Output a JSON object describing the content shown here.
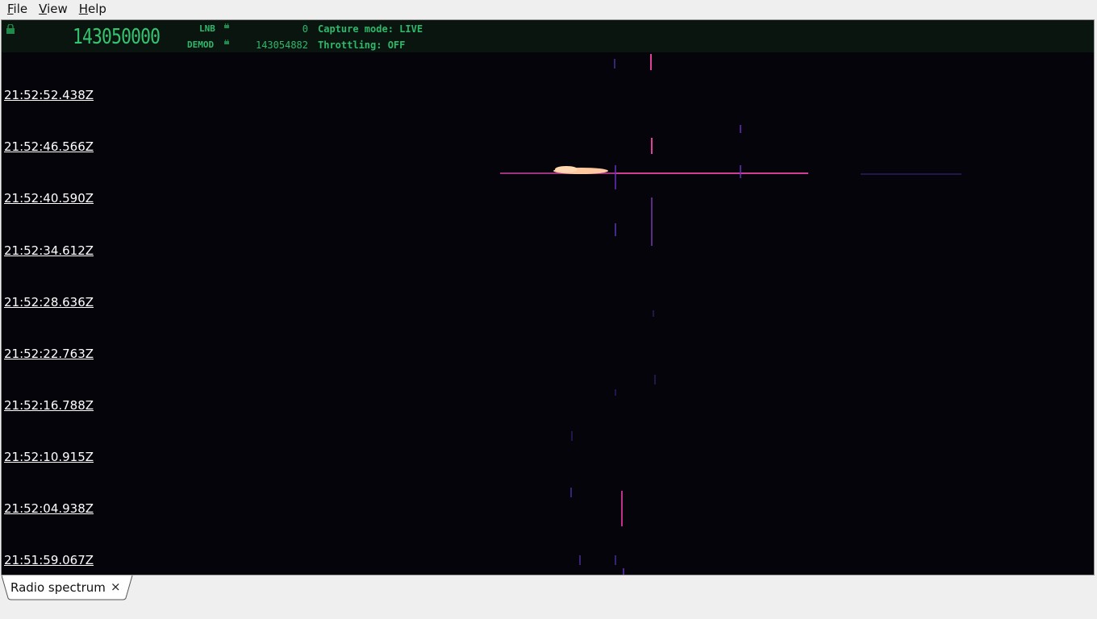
{
  "menu": [
    {
      "mnemonic": "F",
      "rest": "ile"
    },
    {
      "mnemonic": "V",
      "rest": "iew"
    },
    {
      "mnemonic": "H",
      "rest": "elp"
    }
  ],
  "hud": {
    "frequency": "143050000",
    "lnb_label": "LNB",
    "lnb_value": "0",
    "demod_label": "DEMOD",
    "demod_value": "143054882",
    "capture_mode": "Capture mode: LIVE",
    "throttling": "Throttling: OFF"
  },
  "time_labels": [
    "21:52:52.438Z",
    "21:52:46.566Z",
    "21:52:40.590Z",
    "21:52:34.612Z",
    "21:52:28.636Z",
    "21:52:22.763Z",
    "21:52:16.788Z",
    "21:52:10.915Z",
    "21:52:04.938Z",
    "21:51:59.067Z"
  ],
  "tab": {
    "label": "Radio spectrum",
    "close": "×"
  },
  "colors": {
    "hud_green": "#2fb86a",
    "waterfall_bg": "#05040a",
    "signal_hot": "#ffc9a0",
    "signal_mid": "#e0409a",
    "signal_low": "#6a2ec0"
  }
}
